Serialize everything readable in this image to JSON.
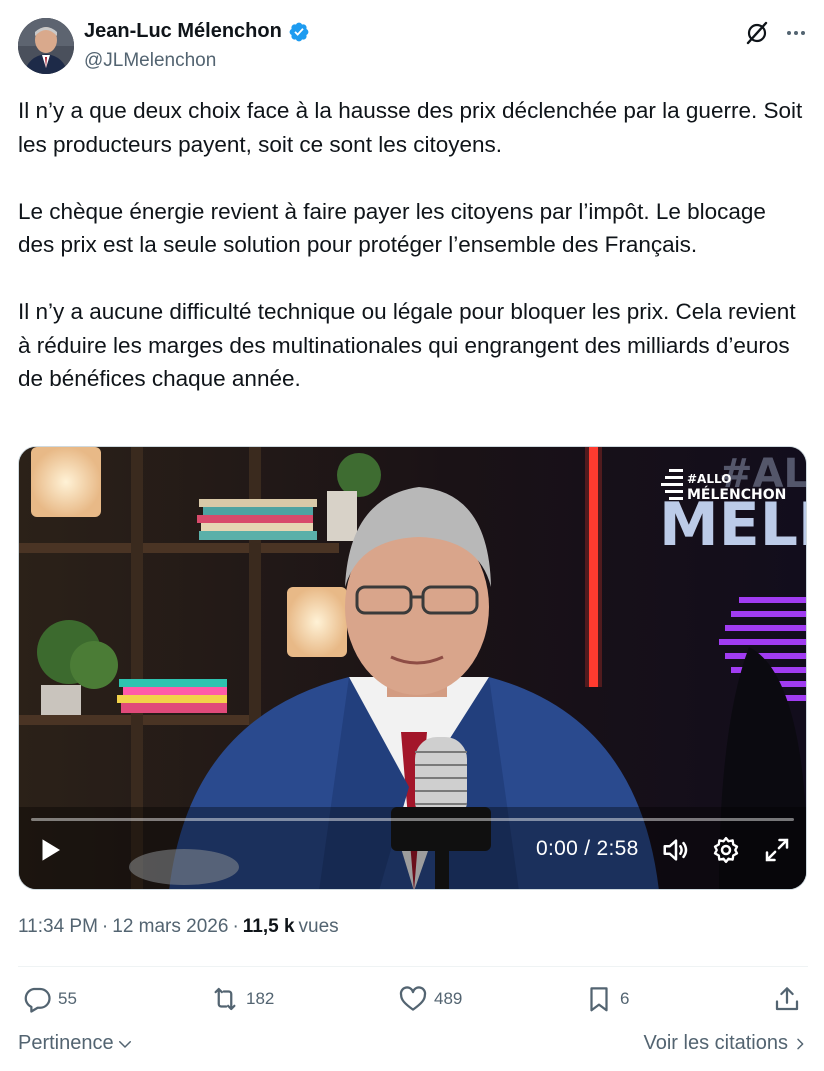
{
  "author": {
    "display_name": "Jean-Luc Mélenchon",
    "handle": "@JLMelenchon",
    "verified": true
  },
  "tweet": {
    "paragraphs": [
      "Il n’y a que deux choix face à la hausse des prix déclenchée par la guerre. Soit les producteurs payent, soit ce sont les citoyens.",
      "Le chèque énergie revient à faire payer les citoyens par l’impôt. Le blocage des prix est la seule solution pour protéger l’ensemble des Français.",
      "Il n’y a aucune difficulté technique ou légale pour bloquer les prix. Cela revient à réduire les marges des multinationales qui engrangent des milliards d’euros de bénéfices chaque année."
    ]
  },
  "video": {
    "current_time": "0:00",
    "separator": " / ",
    "duration": "2:58",
    "overlay_logo": "#ALLO MÉLENCHON",
    "backdrop_text": "#AL MELEN",
    "progress": 0
  },
  "meta": {
    "time": "11:34 PM",
    "dot": "·",
    "date": "12 mars 2026",
    "views_count": "11,5 k",
    "views_label": "vues"
  },
  "actions": {
    "replies": "55",
    "reposts": "182",
    "likes": "489",
    "bookmarks": "6"
  },
  "footer": {
    "sort_label": "Pertinence",
    "quotes_label": "Voir les citations"
  },
  "icons": {
    "verified": "verified-badge-icon",
    "grok": "grok-icon",
    "more": "more-icon",
    "play": "play-icon",
    "volume": "volume-icon",
    "settings": "gear-icon",
    "fullscreen": "fullscreen-icon",
    "reply": "reply-icon",
    "repost": "repost-icon",
    "like": "heart-icon",
    "bookmark": "bookmark-icon",
    "share": "share-icon"
  },
  "colors": {
    "text": "#0f1419",
    "secondary": "#536471",
    "verified": "#1d9bf0",
    "neon_red": "#ff3b2f",
    "neon_purple": "#a13cf2"
  }
}
